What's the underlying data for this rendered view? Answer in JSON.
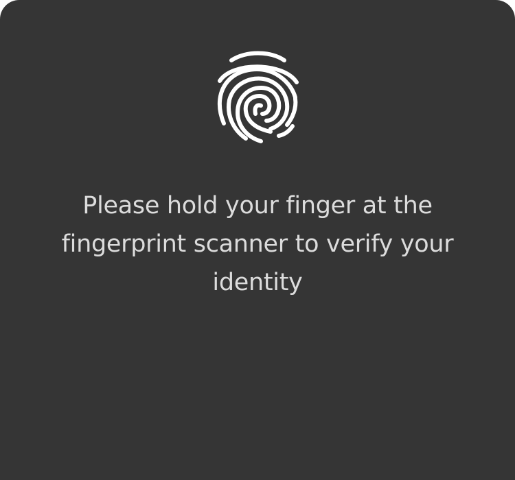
{
  "dialog": {
    "icon": "fingerprint-icon",
    "message": "Please hold your finger at the fingerprint scanner to verify your identity",
    "background_color": "#353535",
    "text_color": "#dcdcdc",
    "icon_color": "#ffffff"
  }
}
